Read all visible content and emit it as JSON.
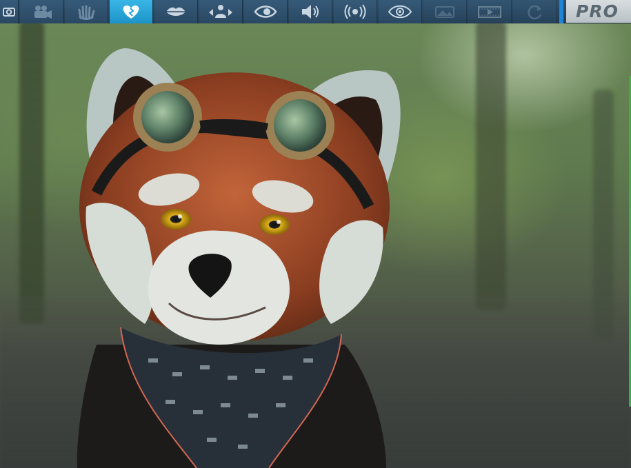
{
  "toolbar": {
    "tools": [
      {
        "id": "camera",
        "icon": "camera-icon"
      },
      {
        "id": "video",
        "icon": "video-camera-icon"
      },
      {
        "id": "gesture",
        "icon": "hand-wave-icon"
      },
      {
        "id": "emotion",
        "icon": "heart-expression-icon",
        "active": true
      },
      {
        "id": "lips",
        "icon": "lips-icon"
      },
      {
        "id": "body",
        "icon": "body-move-icon"
      },
      {
        "id": "eye",
        "icon": "eye-icon"
      },
      {
        "id": "sound",
        "icon": "speaker-icon"
      },
      {
        "id": "broadcast",
        "icon": "broadcast-icon"
      },
      {
        "id": "watch",
        "icon": "watch-eye-icon"
      },
      {
        "id": "scene",
        "icon": "scene-icon",
        "dim": true
      },
      {
        "id": "film",
        "icon": "film-strip-icon",
        "dim": true
      },
      {
        "id": "refresh",
        "icon": "refresh-icon",
        "dim": true
      }
    ],
    "brand_label": "PRO"
  },
  "colors": {
    "toolbar_bg": "#2f4f6a",
    "active_tab": "#2aa6dc",
    "brand_bg": "#c8cfd4",
    "status_rail": "#3fae4a"
  }
}
